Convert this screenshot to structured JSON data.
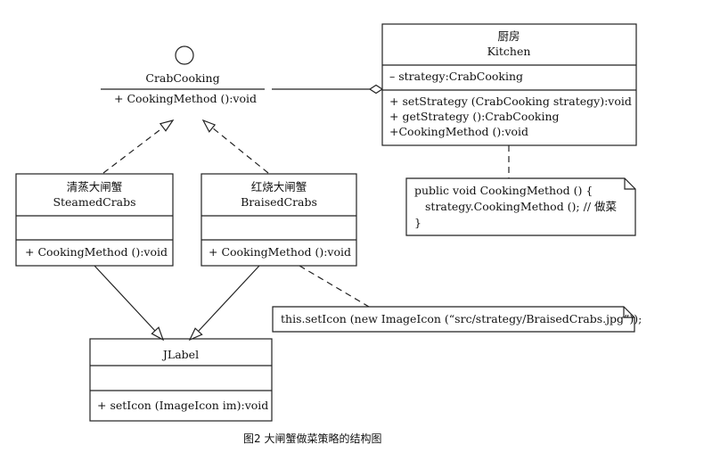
{
  "diagram": {
    "interface": {
      "name": "CrabCooking",
      "method": "+ CookingMethod ():void"
    },
    "kitchen": {
      "title_cn": "厨房",
      "title_en": "Kitchen",
      "attribute": "– strategy:CrabCooking",
      "methods": [
        "+ setStrategy (CrabCooking strategy):void",
        "+ getStrategy ():CrabCooking",
        "+CookingMethod ():void"
      ]
    },
    "kitchen_note": {
      "lines": [
        "public void CookingMethod () {",
        "strategy.CookingMethod ();  // 做菜",
        "}"
      ]
    },
    "steamed": {
      "title_cn": "清蒸大闸蟹",
      "title_en": "SteamedCrabs",
      "method": "+ CookingMethod ():void"
    },
    "braised": {
      "title_cn": "红烧大闸蟹",
      "title_en": "BraisedCrabs",
      "method": "+ CookingMethod ():void"
    },
    "braised_note": {
      "text": "this.setIcon (new ImageIcon (“src/strategy/BraisedCrabs.jpg”));"
    },
    "jlabel": {
      "name": "JLabel",
      "method": "+ setIcon (ImageIcon im):void"
    },
    "caption": "图2 大闸蟹做菜策略的结构图"
  }
}
